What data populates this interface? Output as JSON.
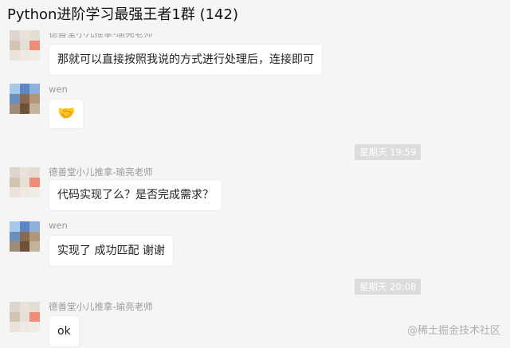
{
  "window": {
    "title": "Python进阶学习最强王者1群 (142)"
  },
  "messages": [
    {
      "sender": "德善堂小儿推拿-瑜亮老师",
      "text": "那就可以直接按照我说的方式进行处理后，连接即可"
    },
    {
      "sender": "wen",
      "text": "🤝"
    },
    {
      "time": "星期天 19:59"
    },
    {
      "sender": "德善堂小儿推拿-瑜亮老师",
      "text": "代码实现了么？是否完成需求？"
    },
    {
      "sender": "wen",
      "text": "实现了 成功匹配 谢谢"
    },
    {
      "time": "星期天 20:08"
    },
    {
      "sender": "德善堂小儿推拿-瑜亮老师",
      "text": "ok"
    }
  ],
  "watermark": "@稀土掘金技术社区",
  "colors": {
    "background": "#f5f5f5",
    "bubble": "#ffffff",
    "time_pill": "#dcdcdc",
    "sender_text": "#9a9a9a"
  }
}
